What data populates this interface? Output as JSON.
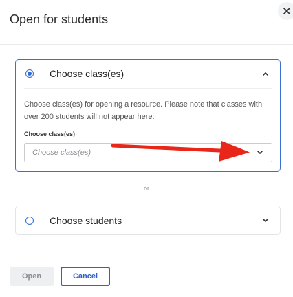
{
  "dialog": {
    "title": "Open for students"
  },
  "options": {
    "classes": {
      "label": "Choose class(es)",
      "selected": true,
      "description": "Choose class(es) for opening a resource. Please note that classes with over 200 students will not appear here.",
      "field_label": "Choose class(es)",
      "placeholder": "Choose class(es)"
    },
    "separator": "or",
    "students": {
      "label": "Choose students",
      "selected": false
    }
  },
  "footer": {
    "open_label": "Open",
    "cancel_label": "Cancel"
  },
  "colors": {
    "accent": "#2f6cd8",
    "annotation_arrow": "#e8261a"
  },
  "icons": {
    "close": "close-icon",
    "expanded": "chevron-up-icon",
    "collapsed": "chevron-down-icon",
    "dropdown": "chevron-down-icon",
    "annotation": "red-arrow"
  }
}
